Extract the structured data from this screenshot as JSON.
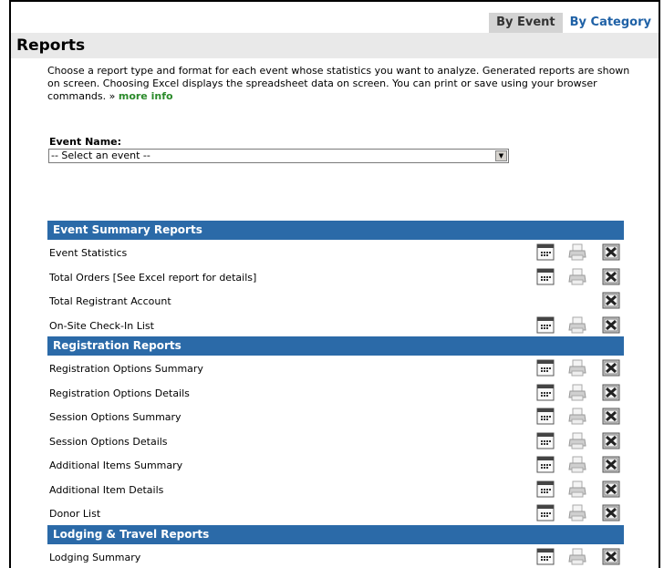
{
  "tabs": [
    {
      "label": "By Event",
      "active": true
    },
    {
      "label": "By Category",
      "active": false
    }
  ],
  "page_title": "Reports",
  "intro": {
    "text": "Choose a report type and format for each event whose statistics you want to analyze. Generated reports are shown on screen. Choosing Excel displays the spreadsheet data on screen. You can print or save using your browser commands. » ",
    "more_link": "more info"
  },
  "event": {
    "label": "Event Name:",
    "selected": "-- Select an event --"
  },
  "sections": [
    {
      "title": "Event Summary Reports",
      "rows": [
        {
          "label": "Event Statistics",
          "icons": [
            "calendar-icon",
            "printer-icon",
            "excel-icon"
          ]
        },
        {
          "label": "Total Orders [See Excel report for details]",
          "icons": [
            "calendar-icon",
            "printer-icon",
            "excel-icon"
          ]
        },
        {
          "label": "Total Registrant Account",
          "icons": [
            "excel-icon"
          ]
        },
        {
          "label": "On-Site Check-In List",
          "icons": [
            "calendar-icon",
            "printer-icon",
            "excel-icon"
          ]
        }
      ]
    },
    {
      "title": "Registration Reports",
      "rows": [
        {
          "label": "Registration Options Summary",
          "icons": [
            "calendar-icon",
            "printer-icon",
            "excel-icon"
          ]
        },
        {
          "label": "Registration Options Details",
          "icons": [
            "calendar-icon",
            "printer-icon",
            "excel-icon"
          ]
        },
        {
          "label": "Session Options Summary",
          "icons": [
            "calendar-icon",
            "printer-icon",
            "excel-icon"
          ]
        },
        {
          "label": "Session Options Details",
          "icons": [
            "calendar-icon",
            "printer-icon",
            "excel-icon"
          ]
        },
        {
          "label": "Additional Items Summary",
          "icons": [
            "calendar-icon",
            "printer-icon",
            "excel-icon"
          ]
        },
        {
          "label": "Additional Item Details",
          "icons": [
            "calendar-icon",
            "printer-icon",
            "excel-icon"
          ]
        },
        {
          "label": "Donor List",
          "icons": [
            "calendar-icon",
            "printer-icon",
            "excel-icon"
          ]
        }
      ]
    },
    {
      "title": "Lodging & Travel Reports",
      "rows": [
        {
          "label": "Lodging Summary",
          "icons": [
            "calendar-icon",
            "printer-icon",
            "excel-icon"
          ]
        }
      ]
    }
  ],
  "colors": {
    "section_header_bg": "#2b6aa8",
    "tab_link": "#1f61a6",
    "more_link": "#2a8a2a",
    "title_bar_bg": "#e9e9e9"
  }
}
